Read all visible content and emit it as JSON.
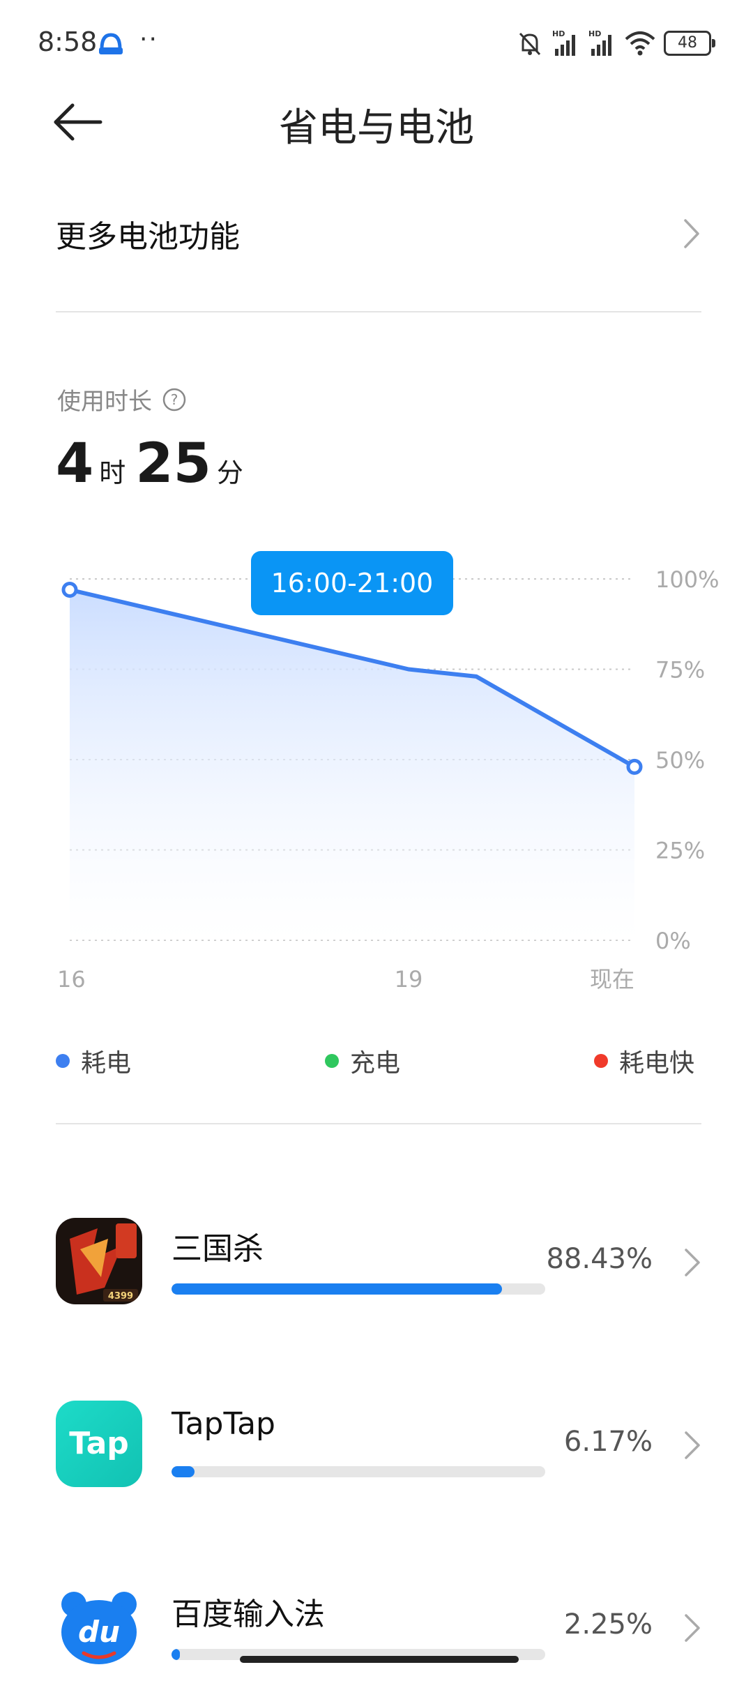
{
  "status_bar": {
    "time": "8:58",
    "dots": "··",
    "battery": "48",
    "icons": [
      "bell-off-icon",
      "signal-hd-icon",
      "signal-hd-icon",
      "wifi-icon",
      "battery-icon"
    ]
  },
  "header": {
    "title": "省电与电池",
    "back_icon": "arrow-left-icon"
  },
  "more_battery": {
    "label": "更多电池功能"
  },
  "usage": {
    "label": "使用时长",
    "hours": "4",
    "hours_unit": "时",
    "minutes": "25",
    "minutes_unit": "分"
  },
  "chart_data": {
    "type": "area",
    "tooltip": "16:00-21:00",
    "x_ticks": [
      "16",
      "19",
      "现在"
    ],
    "y_ticks": [
      "100%",
      "75%",
      "50%",
      "25%",
      "0%"
    ],
    "ylim": [
      0,
      100
    ],
    "xlim": [
      16,
      21
    ],
    "series": [
      {
        "x": [
          16,
          19,
          19.6,
          21
        ],
        "y": [
          97,
          75,
          73,
          48
        ]
      }
    ],
    "grid": true,
    "colors": {
      "line": "#3d7ff0",
      "fill": "#cfe0ff"
    }
  },
  "legend": [
    {
      "label": "耗电",
      "color": "#3d7ff0"
    },
    {
      "label": "充电",
      "color": "#2fc75e"
    },
    {
      "label": "耗电快",
      "color": "#f03a2a"
    }
  ],
  "apps": [
    {
      "name": "三国杀",
      "percent": "88.43%",
      "value": 0.8843,
      "icon": "sanguosha-app-icon"
    },
    {
      "name": "TapTap",
      "percent": "6.17%",
      "value": 0.0617,
      "icon": "taptap-app-icon",
      "icon_text": "Tap"
    },
    {
      "name": "百度输入法",
      "percent": "2.25%",
      "value": 0.0225,
      "icon": "baidu-input-app-icon",
      "icon_text": "du"
    }
  ]
}
